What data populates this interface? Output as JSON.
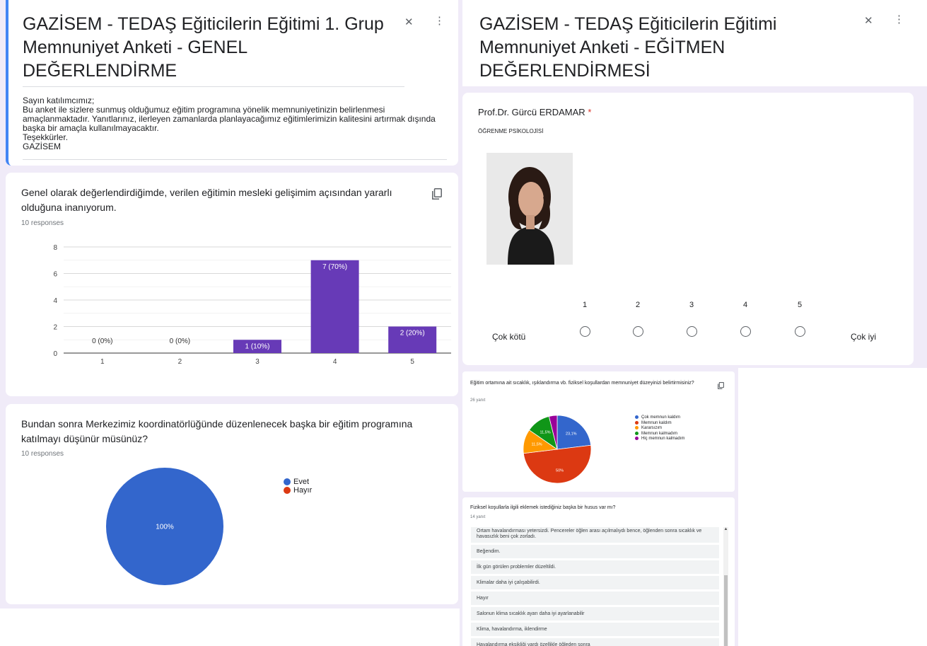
{
  "left": {
    "header": {
      "title": "GAZİSEM - TEDAŞ Eğiticilerin Eğitimi 1. Grup Memnuniyet Anketi - GENEL DEĞERLENDİRME",
      "description": [
        "Sayın katılımcımız;",
        "Bu anket ile sizlere sunmuş olduğumuz eğitim programına yönelik memnuniyetinizin belirlenmesi amaçlanmaktadır. Yanıtlarınız, ilerleyen zamanlarda planlayacağımız eğitimlerimizin kalitesini artırmak dışında başka bir amaçla kullanılmayacaktır.",
        "Teşekkürler.",
        "GAZİSEM"
      ],
      "collapse_icon": "collapse-icon",
      "more_icon": "more-vert-icon"
    },
    "q1": {
      "question": "Genel olarak değerlendirdiğimde, verilen eğitimin mesleki gelişimim açısından yararlı olduğuna inanıyorum.",
      "responses": "10 responses",
      "copy_icon": "copy-icon"
    },
    "q2": {
      "question": "Bundan sonra Merkezimiz koordinatörlüğünde düzenlenecek başka bir eğitim programına katılmayı düşünür müsünüz?",
      "responses": "10 responses"
    }
  },
  "right": {
    "header": {
      "title": "GAZİSEM - TEDAŞ Eğiticilerin Eğitimi Memnuniyet Anketi - EĞİTMEN DEĞERLENDİRMESİ"
    },
    "trainer": {
      "name": "Prof.Dr. Gürcü ERDAMAR",
      "required_mark": "*",
      "topic": "ÖĞRENME PSİKOLOJİSİ",
      "scale_labels": [
        "1",
        "2",
        "3",
        "4",
        "5"
      ],
      "low_label": "Çok kötü",
      "high_label": "Çok iyi"
    },
    "q3": {
      "question": "Eğitim ortamına ait sıcaklık, ışıklandırma vb. fiziksel koşullardan memnuniyet düzeyinizi belirtirmisiniz?",
      "responses": "26 yanıt"
    },
    "q4": {
      "question": "Fiziksel koşullarla ilgili eklemek istediğiniz başka bir husus var mı?",
      "responses": "14 yanıt",
      "answers": [
        "Ortam havalandırması yetersizdi. Pencereler öğlen arası açılmalıydı bence, öğlenden sonra sıcaklık ve havasızlık beni çok zorladı.",
        "Beğendim.",
        "İlk gün görülen problemler düzeltildi.",
        "Klimalar daha iyi çalışabilirdi.",
        "Hayır",
        "Salonun klima sıcaklık ayarı daha iyi ayarlanabilir",
        "Klima, havalandırma, iklendirme",
        "Havalandırma eksikliği vardı özellikle öğleden sonra"
      ]
    }
  },
  "chart_data": [
    {
      "type": "bar",
      "categories": [
        "1",
        "2",
        "3",
        "4",
        "5"
      ],
      "values": [
        0,
        0,
        1,
        7,
        2
      ],
      "labels": [
        "0 (0%)",
        "0 (0%)",
        "1 (10%)",
        "7 (70%)",
        "2 (20%)"
      ],
      "yticks": [
        "0",
        "2",
        "4",
        "6",
        "8"
      ],
      "ylim": [
        0,
        8
      ],
      "grid": true,
      "color": "#673ab7"
    },
    {
      "type": "pie",
      "series": [
        {
          "name": "Evet",
          "value": 100,
          "color": "#3366cc"
        },
        {
          "name": "Hayır",
          "value": 0,
          "color": "#dc3912"
        }
      ],
      "slice_label": "100%",
      "legend": "right"
    },
    {
      "type": "pie",
      "series": [
        {
          "name": "Çok memnun kaldım",
          "value": 23.1,
          "label": "23,1%",
          "color": "#3366cc"
        },
        {
          "name": "Memnun kaldım",
          "value": 50,
          "label": "50%",
          "color": "#dc3912"
        },
        {
          "name": "Kararsızım",
          "value": 11.5,
          "label": "11,5%",
          "color": "#ff9900"
        },
        {
          "name": "Memnun kalmadım",
          "value": 11.5,
          "label": "11,5%",
          "color": "#109618"
        },
        {
          "name": "Hiç memnun kalmadım",
          "value": 3.9,
          "label": "",
          "color": "#990099"
        }
      ],
      "legend": "right"
    }
  ]
}
